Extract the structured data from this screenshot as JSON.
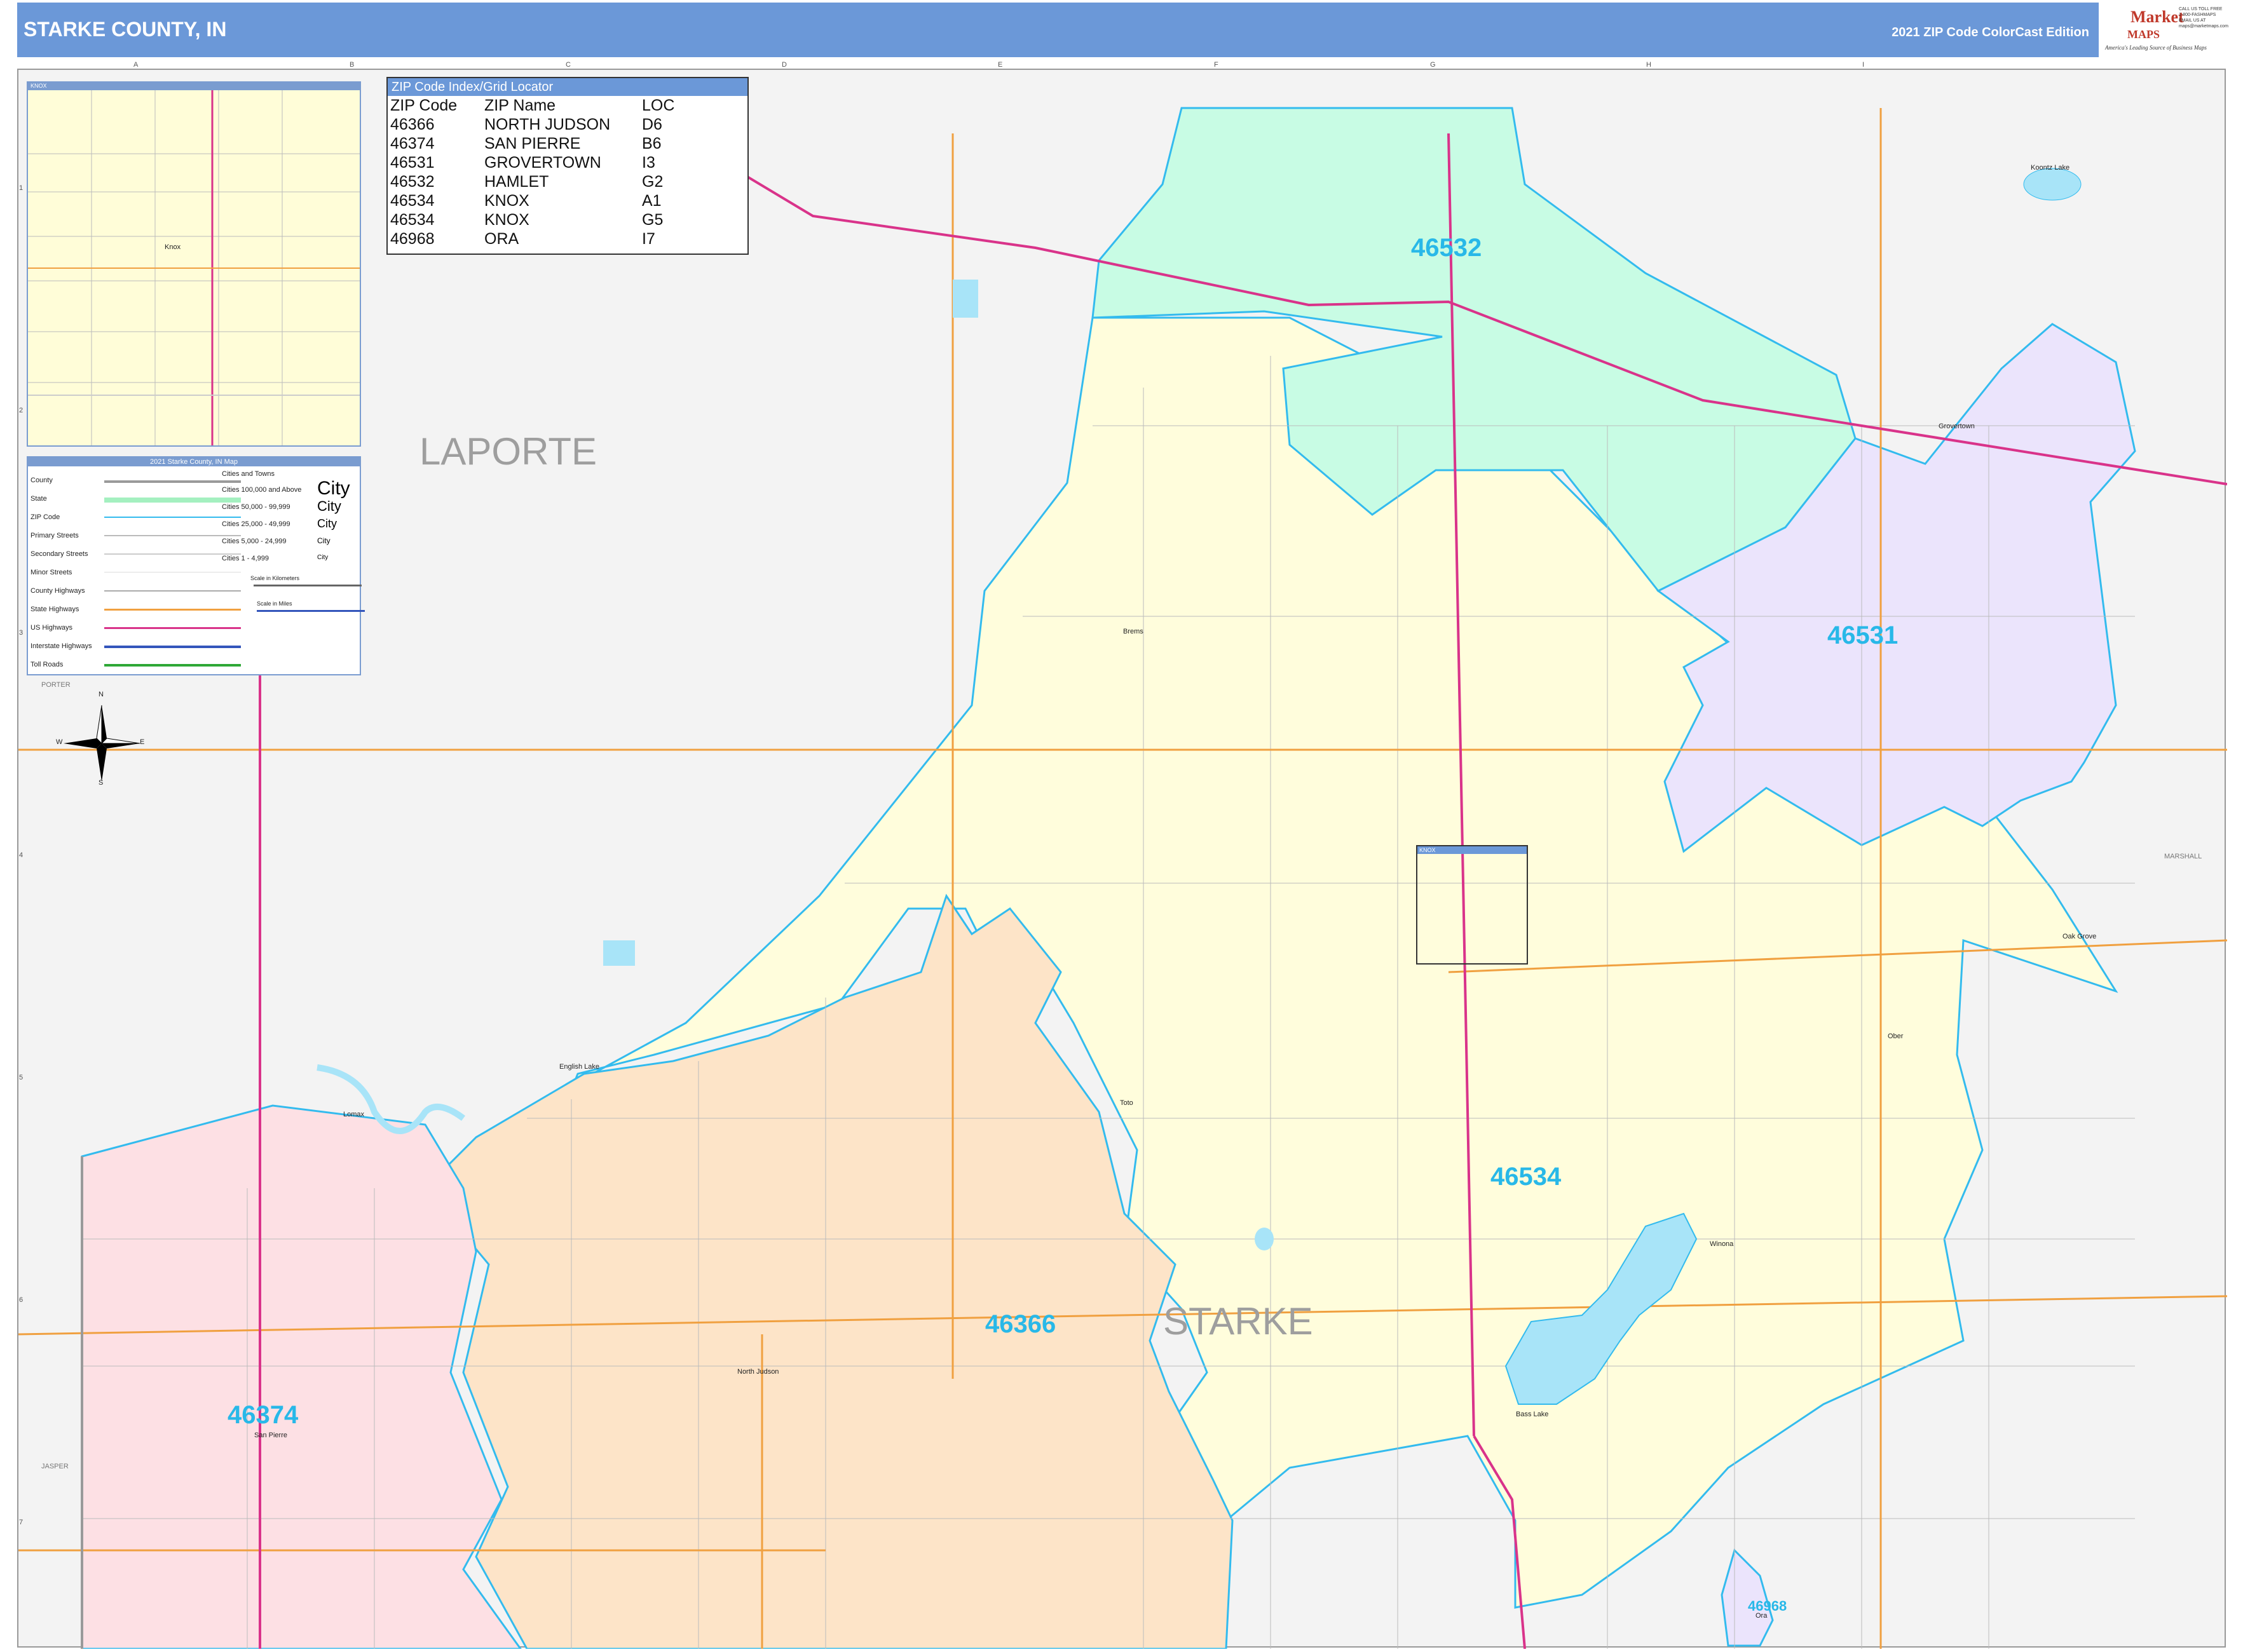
{
  "header": {
    "title": "STARKE COUNTY, IN",
    "edition": "2021 ZIP Code ColorCast Edition",
    "logo_main": "Market",
    "logo_sub": "MAPS",
    "logo_tagline": "America's Leading Source of Business Maps",
    "logo_contact": "CALL US TOLL FREE 1-800-FASHMAPS EMAIL US AT maps@marketmaps.com"
  },
  "grid": {
    "columns": [
      "A",
      "B",
      "C",
      "D",
      "E",
      "F",
      "G",
      "H",
      "I"
    ],
    "rows": [
      "1",
      "2",
      "3",
      "4",
      "5",
      "6",
      "7"
    ]
  },
  "inset": {
    "label": "KNOX",
    "town": "Knox"
  },
  "zip_index": {
    "title": "ZIP Code Index/Grid Locator",
    "headers": [
      "ZIP Code",
      "ZIP Name",
      "LOC"
    ],
    "rows": [
      [
        "46366",
        "NORTH JUDSON",
        "D6"
      ],
      [
        "46374",
        "SAN PIERRE",
        "B6"
      ],
      [
        "46531",
        "GROVERTOWN",
        "I3"
      ],
      [
        "46532",
        "HAMLET",
        "G2"
      ],
      [
        "46534",
        "KNOX",
        "A1"
      ],
      [
        "46534",
        "KNOX",
        "G5"
      ],
      [
        "46968",
        "ORA",
        "I7"
      ]
    ]
  },
  "legend": {
    "title": "2021 Starke County, IN Map",
    "items": [
      {
        "label": "County",
        "color": "#9a9a9a"
      },
      {
        "label": "State",
        "color": "#a4f0c0"
      },
      {
        "label": "ZIP Code",
        "color": "#33bbee"
      },
      {
        "label": "Primary Streets",
        "color": "#bbbbbb"
      },
      {
        "label": "Secondary Streets",
        "color": "#cccccc"
      },
      {
        "label": "Minor Streets",
        "color": "#dddddd"
      },
      {
        "label": "County Highways",
        "color": "#aaaaaa"
      },
      {
        "label": "State Highways",
        "color": "#f0a040"
      },
      {
        "label": "US Highways",
        "color": "#d9338a"
      },
      {
        "label": "Interstate Highways",
        "color": "#3355bb"
      },
      {
        "label": "Toll Roads",
        "color": "#2ea836"
      }
    ],
    "city_header": "Cities and Towns",
    "cities": [
      "Cities 100,000 and Above",
      "Cities 50,000 - 99,999",
      "Cities 25,000 - 49,999",
      "Cities 5,000 - 24,999",
      "Cities 1 - 4,999"
    ],
    "city_symbols": [
      "City",
      "City",
      "City",
      "City",
      "City"
    ],
    "scale_km": "Scale in Kilometers",
    "scale_mi": "Scale in Miles"
  },
  "compass": {
    "n": "N",
    "s": "S",
    "e": "E",
    "w": "W"
  },
  "regions": {
    "laporte": "LAPORTE",
    "starke": "STARKE",
    "porter": "PORTER",
    "jasper": "JASPER",
    "marshall": "MARSHALL"
  },
  "zips": {
    "z46532": "46532",
    "z46531": "46531",
    "z46534": "46534",
    "z46366": "46366",
    "z46374": "46374",
    "z46968": "46968"
  },
  "towns": {
    "knox_box": "KNOX",
    "grovertown": "Grovertown",
    "koontz_lake": "Koontz Lake",
    "brems": "Brems",
    "oak_grove": "Oak Grove",
    "ober": "Ober",
    "english_lake": "English Lake",
    "lomax": "Lomax",
    "toto": "Toto",
    "winona": "Winona",
    "north_judson": "North Judson",
    "san_pierre": "San Pierre",
    "bass_lake": "Bass Lake",
    "ora": "Ora"
  },
  "colors": {
    "z46532": "#c8fce4",
    "z46531": "#ebe4fc",
    "z46534": "#fffddc",
    "z46366": "#fde4c8",
    "z46374": "#fde0e4",
    "zip_border": "#33bbee",
    "us_highway": "#d9338a",
    "state_highway": "#f0a040",
    "water": "#a8e4f8"
  }
}
